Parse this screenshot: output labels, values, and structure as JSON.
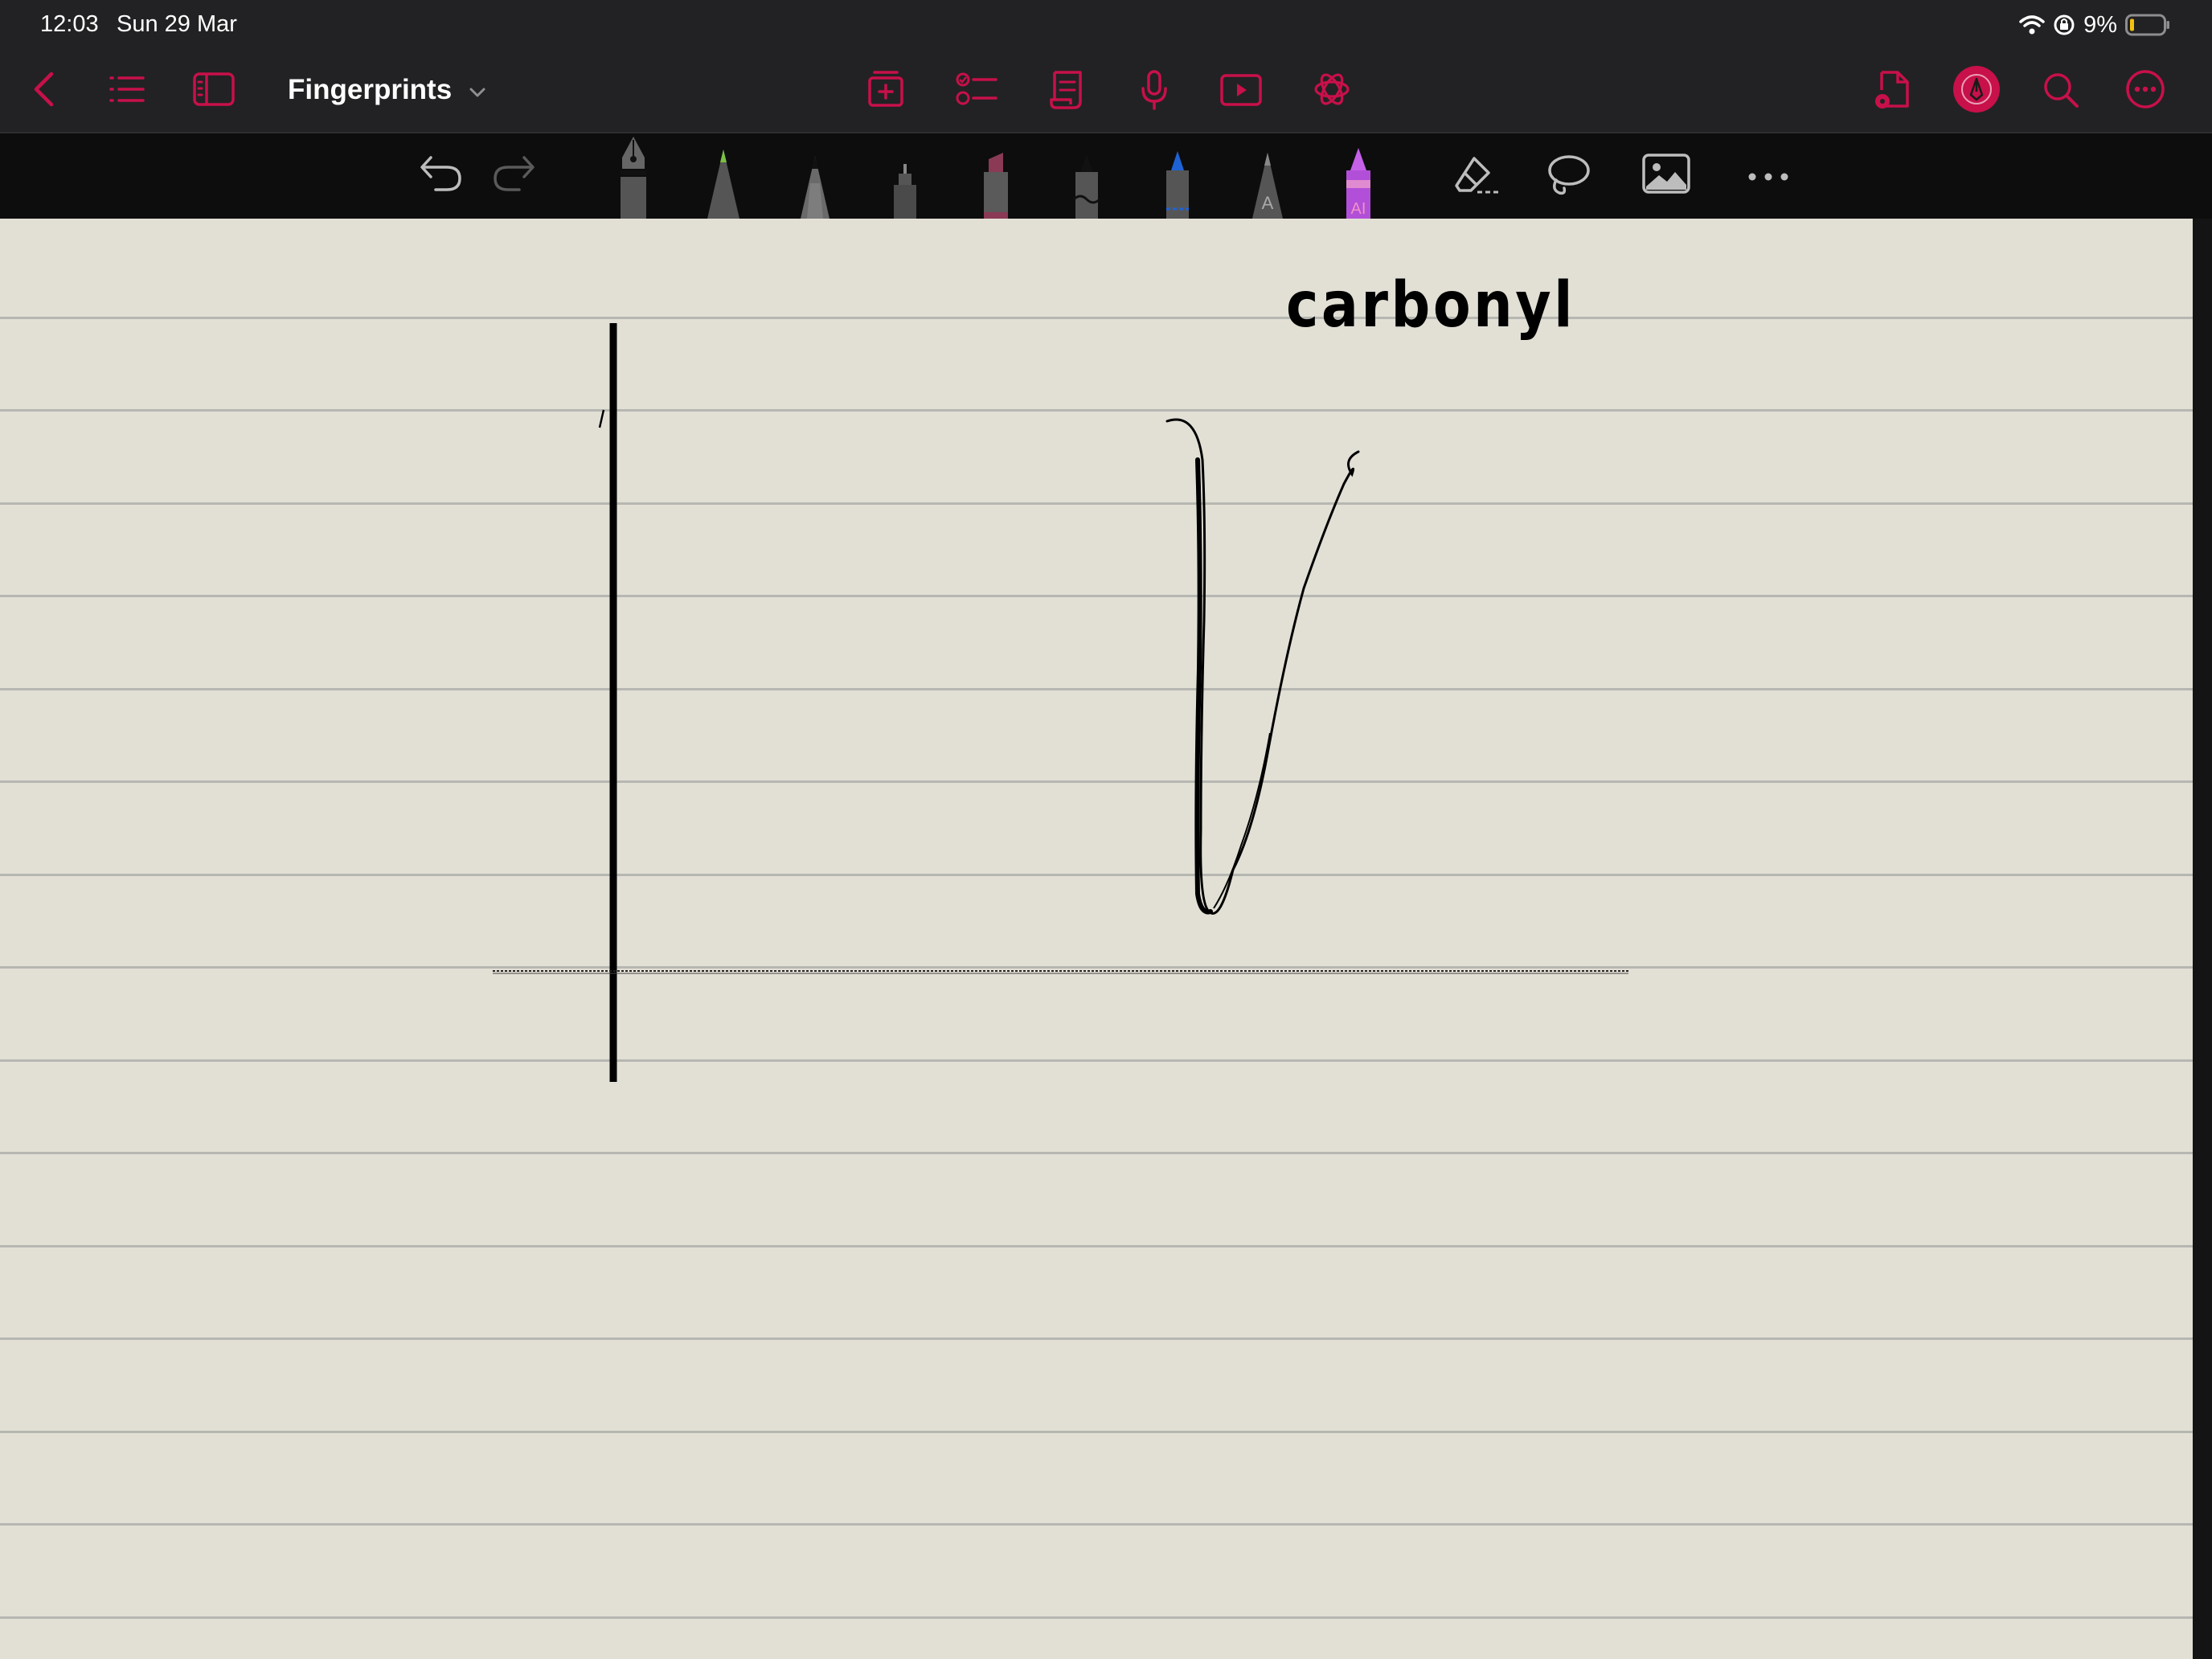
{
  "status_bar": {
    "time": "12:03",
    "date": "Sun 29 Mar",
    "battery_percent": "9%",
    "icons": [
      "wifi-icon",
      "orientation-lock-icon",
      "battery-icon"
    ]
  },
  "nav_bar": {
    "document_title": "Fingerprints",
    "accent_color": "#c8104a",
    "left_icons": [
      "back-chevron-icon",
      "outline-list-icon",
      "sidebar-icon"
    ],
    "center_icons": [
      "add-page-icon",
      "checklist-icon",
      "scroll-page-icon",
      "microphone-icon",
      "video-icon",
      "ai-assistant-icon"
    ],
    "right_icons": [
      "document-share-icon",
      "pen-mode-icon",
      "search-icon",
      "more-options-icon"
    ]
  },
  "tool_bar": {
    "tools": [
      "undo-icon",
      "redo-icon",
      "fountain-pen-icon",
      "green-pencil-icon",
      "pencil-icon",
      "fineliner-icon",
      "highlighter-icon",
      "brush-pen-icon",
      "blue-pen-icon",
      "text-pen-icon",
      "ai-pen-icon",
      "eraser-icon",
      "lasso-icon",
      "image-icon",
      "more-tools-icon"
    ]
  },
  "canvas": {
    "paper_color": "#e2e0d5",
    "rule_color": "#b7b7b2",
    "handwriting": {
      "label": "carbonyl"
    }
  }
}
